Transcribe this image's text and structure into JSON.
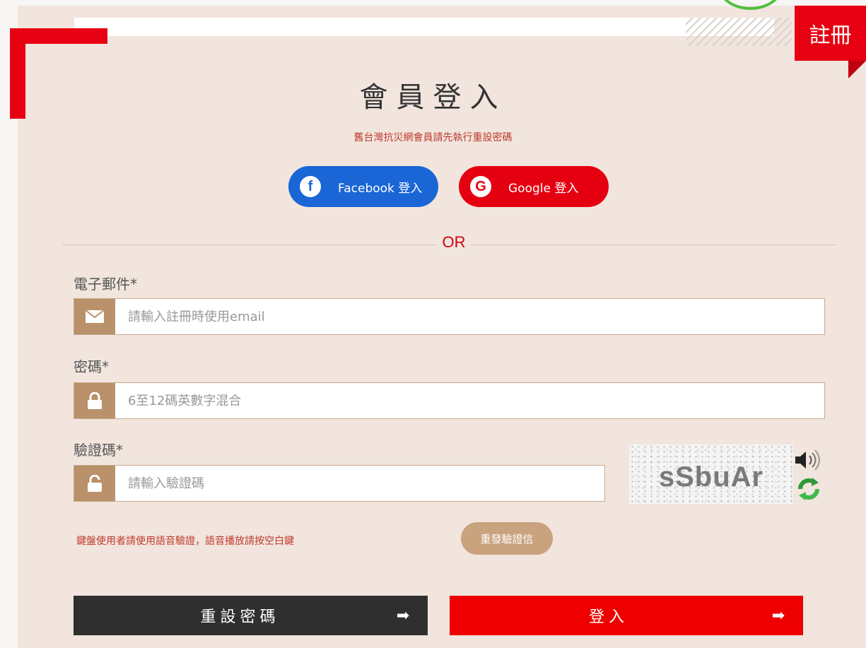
{
  "header": {
    "register_label": "註冊"
  },
  "page": {
    "title": "會員登入",
    "notice": "舊台灣抗災網會員請先執行重設密碼"
  },
  "social": {
    "facebook_label": "Facebook 登入",
    "facebook_icon": "f",
    "google_label": "Google 登入",
    "google_icon": "G"
  },
  "divider": {
    "or_label": "OR"
  },
  "form": {
    "email": {
      "label": "電子郵件*",
      "placeholder": "請輸入註冊時使用email",
      "value": ""
    },
    "password": {
      "label": "密碼*",
      "placeholder": "6至12碼英數字混合",
      "value": ""
    },
    "captcha": {
      "label": "驗證碼*",
      "placeholder": "請輸入驗證碼",
      "value": "",
      "image_text": "sSbuAr"
    }
  },
  "hint": "鍵盤使用者請使用語音驗證，語音播放請按空白鍵",
  "buttons": {
    "resend_label": "重發驗證信",
    "reset_label": "重設密碼",
    "login_label": "登入",
    "arrow": "➡"
  },
  "colors": {
    "accent_red": "#e60012",
    "facebook_blue": "#1a66d6",
    "tan": "#b9916a",
    "panel_bg": "#f1e5de"
  }
}
